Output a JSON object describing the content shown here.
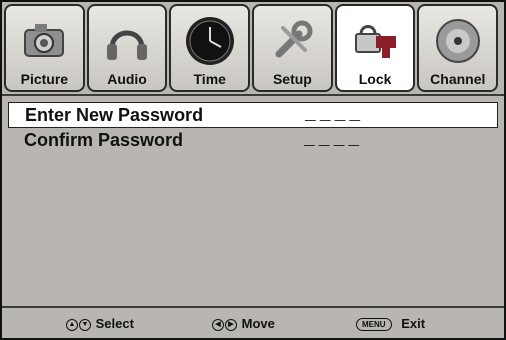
{
  "tabs": [
    {
      "label": "Picture",
      "icon": "camera-icon",
      "active": false
    },
    {
      "label": "Audio",
      "icon": "headphones-icon",
      "active": false
    },
    {
      "label": "Time",
      "icon": "clock-icon",
      "active": false
    },
    {
      "label": "Setup",
      "icon": "tools-icon",
      "active": false
    },
    {
      "label": "Lock",
      "icon": "lock-key-icon",
      "active": true
    },
    {
      "label": "Channel",
      "icon": "satellite-icon",
      "active": false
    }
  ],
  "menu": {
    "rows": [
      {
        "label": "Enter New Password",
        "value": "____",
        "selected": true
      },
      {
        "label": "Confirm Password",
        "value": "____",
        "selected": false
      }
    ]
  },
  "footer": {
    "select_label": "Select",
    "move_label": "Move",
    "menu_key": "MENU",
    "exit_label": "Exit"
  }
}
